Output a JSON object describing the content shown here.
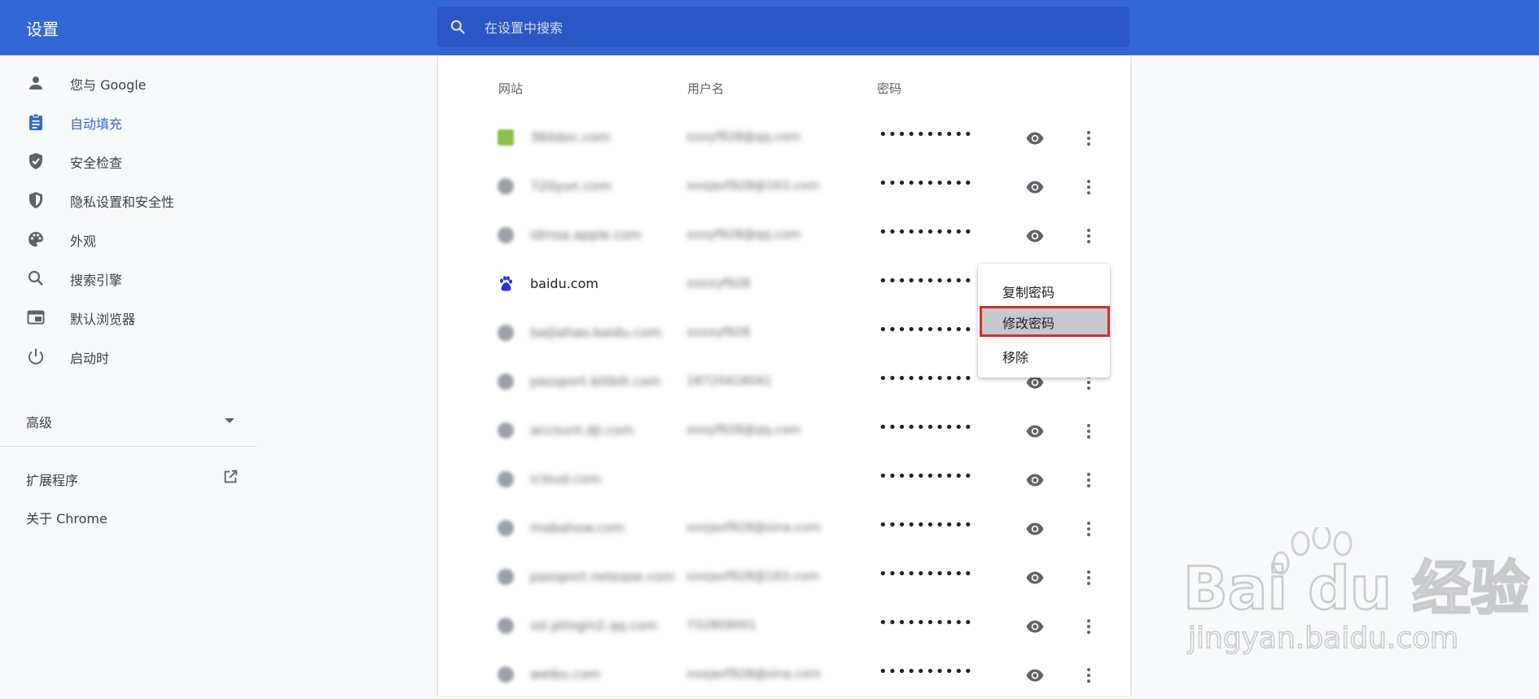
{
  "app": {
    "title": "设置"
  },
  "search": {
    "placeholder": "在设置中搜索",
    "value": ""
  },
  "sidebar": {
    "items": [
      {
        "label": "您与 Google",
        "icon": "person-icon"
      },
      {
        "label": "自动填充",
        "icon": "clipboard-icon",
        "active": true
      },
      {
        "label": "安全检查",
        "icon": "shield-check-icon"
      },
      {
        "label": "隐私设置和安全性",
        "icon": "shield-half-icon"
      },
      {
        "label": "外观",
        "icon": "palette-icon"
      },
      {
        "label": "搜索引擎",
        "icon": "search-icon"
      },
      {
        "label": "默认浏览器",
        "icon": "browser-icon"
      },
      {
        "label": "启动时",
        "icon": "power-icon"
      }
    ],
    "advanced": "高级",
    "extensions": "扩展程序",
    "about": "关于 Chrome"
  },
  "passwords": {
    "columns": {
      "site": "网站",
      "username": "用户名",
      "password": "密码"
    },
    "rows": [
      {
        "site": "360doc.com",
        "username": "xxxyf928@qq.com",
        "password": "••••••••••"
      },
      {
        "site": "720yun.com",
        "username": "xxxjaxf928@163.com",
        "password": "••••••••••"
      },
      {
        "site": "idmsa.apple.com",
        "username": "xxxyf928@qq.com",
        "password": "••••••••••"
      },
      {
        "site": "baidu.com",
        "username": "xxxxyf928",
        "password": "••••••••••"
      },
      {
        "site": "baijiahao.baidu.com",
        "username": "xxxxyf928",
        "password": "••••••••••"
      },
      {
        "site": "passport.bilibili.com",
        "username": "18720418041",
        "password": "••••••••••"
      },
      {
        "site": "account.dji.com",
        "username": "xxxyf928@qq.com",
        "password": "••••••••••"
      },
      {
        "site": "icloud.com",
        "username": "",
        "password": "••••••••••"
      },
      {
        "site": "mobahow.com",
        "username": "xxxjaxf928@sina.com",
        "password": "••••••••••"
      },
      {
        "site": "passport.netease.com",
        "username": "xxxjaxf928@163.com",
        "password": "••••••••••"
      },
      {
        "site": "ssl.ptlogin2.qq.com",
        "username": "732809001",
        "password": "••••••••••"
      },
      {
        "site": "weibo.com",
        "username": "xxxjaxf928@sina.com",
        "password": "••••••••••"
      }
    ]
  },
  "context_menu": {
    "items": [
      "复制密码",
      "修改密码",
      "移除"
    ],
    "highlighted": "修改密码",
    "highlight_color": "#d32f2f"
  },
  "watermark": {
    "brand": "Bai du 经验",
    "url": "jingyan.baidu.com"
  },
  "colors": {
    "header": "#3367d6",
    "search_bg": "#2a56c6",
    "accent": "#3367d6",
    "page_bg": "#f8f9fa"
  }
}
